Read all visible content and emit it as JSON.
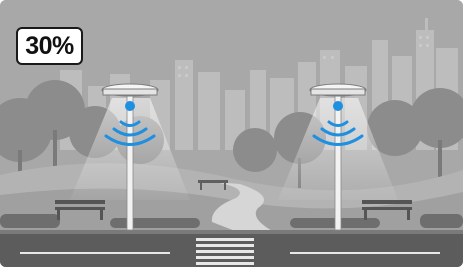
{
  "badge": {
    "brightness_text": "30%"
  },
  "scene": {
    "description_icons": [
      "city-skyline",
      "park-trees",
      "street-lamp-left",
      "street-lamp-right",
      "wireless-signal-icon",
      "bench",
      "crosswalk"
    ],
    "colors": {
      "sky": "#a9a9a9",
      "signal_blue": "#1f8fe0",
      "lamp_light": "#e6e6e6",
      "road": "#5a5a5a"
    }
  }
}
